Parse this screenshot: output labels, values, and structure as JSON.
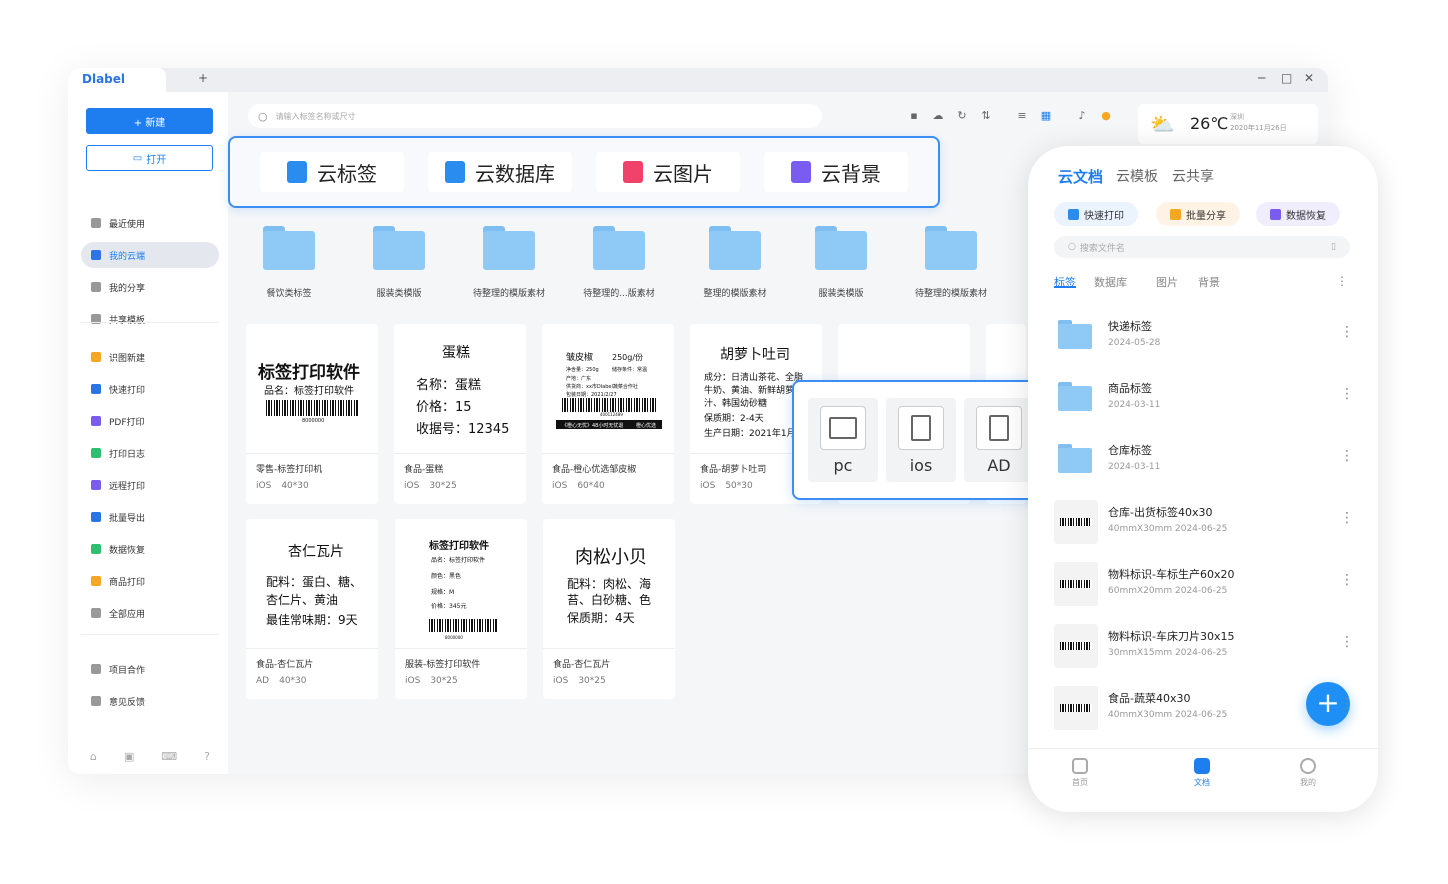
{
  "app": {
    "logo": "label",
    "new_tab": "+",
    "min": "─",
    "max": "□",
    "close": "✕"
  },
  "sidebar": {
    "new_button": "+ 新建",
    "open_button": "打开",
    "group1": [
      {
        "label": "最近使用",
        "color": "#999"
      },
      {
        "label": "我的云端",
        "color": "#2b74e6"
      },
      {
        "label": "我的分享",
        "color": "#999"
      },
      {
        "label": "共享模板",
        "color": "#999"
      }
    ],
    "group2": [
      {
        "label": "识图新建",
        "color": "#f5a623"
      },
      {
        "label": "快速打印",
        "color": "#2b74e6"
      },
      {
        "label": "PDF打印",
        "color": "#7b5cf0"
      },
      {
        "label": "打印日志",
        "color": "#2fbf71"
      },
      {
        "label": "远程打印",
        "color": "#7b5cf0"
      },
      {
        "label": "批量导出",
        "color": "#2b74e6"
      },
      {
        "label": "数据恢复",
        "color": "#2fbf71"
      },
      {
        "label": "商品打印",
        "color": "#f5a623"
      },
      {
        "label": "全部应用",
        "color": "#999"
      }
    ],
    "group3": [
      {
        "label": "项目合作",
        "color": "#999"
      },
      {
        "label": "意见反馈",
        "color": "#999"
      }
    ]
  },
  "search": {
    "placeholder": "请输入标签名称或尺寸"
  },
  "weather": {
    "temp": "26℃",
    "city": "深圳",
    "date": "2020年11月26日"
  },
  "cloud_tabs": [
    {
      "label": "云标签",
      "color": "#2b8cf0"
    },
    {
      "label": "云数据库",
      "color": "#2b8cf0"
    },
    {
      "label": "云图片",
      "color": "#f0426a"
    },
    {
      "label": "云背景",
      "color": "#7b5cf0"
    }
  ],
  "folders": [
    "餐饮类标签",
    "服装类模版",
    "待整理的模版素材",
    "待整理的...版素材",
    "整理的模版素材",
    "服装类模版",
    "待整理的模版素材"
  ],
  "cards": [
    {
      "name": "零售-标签打印机",
      "platform": "iOS",
      "size": "40*30",
      "p1": "标签打印软件",
      "p2": "品名：标签打印软件",
      "code": "8000000"
    },
    {
      "name": "食品-蛋糕",
      "platform": "iOS",
      "size": "30*25",
      "p1": "蛋糕",
      "p2": "名称：蛋糕",
      "p3": "价格：15",
      "p4": "收据号：12345"
    },
    {
      "name": "食品-橙心优选邹皮椒",
      "platform": "iOS",
      "size": "60*40",
      "p1": "皱皮椒",
      "p1b": "250g/份",
      "p2": "净含量：250g",
      "p2b": "储存条件：常温",
      "p3": "产地：广东",
      "p4": "供货商：xx市Dlabel蔬菜合作社",
      "p5": "包装日期：2021/2/27",
      "code": "400112489",
      "f1": "《橙心无忧》48小时无忧退",
      "f2": "橙心优选"
    },
    {
      "name": "食品-胡萝卜吐司",
      "platform": "iOS",
      "size": "50*30",
      "p1": "胡萝卜吐司",
      "p2": "成分：日清山茶花、全脂",
      "p3": "牛奶、黄油、新鲜胡萝",
      "p4": "汁、韩国幼砂糖",
      "p5": "保质期：2-4天",
      "p6": "生产日期：2021年1月"
    },
    {
      "name": "食品-杏仁瓦片",
      "platform": "AD",
      "size": "40*30",
      "p1": "杏仁瓦片",
      "p2": "配料：蛋白、糖、",
      "p3": "杏仁片、黄油",
      "p4": "最佳常味期：9天"
    },
    {
      "name": "服装-标签打印软件",
      "platform": "iOS",
      "size": "30*25",
      "p1": "标签打印软件",
      "p2": "品名：标签打印软件",
      "p3": "颜色：黑色",
      "p4": "规格：M",
      "p5": "价格：345元",
      "code": "8000000"
    },
    {
      "name": "食品-杏仁瓦片",
      "platform": "iOS",
      "size": "30*25",
      "p1": "肉松小贝",
      "p2": "配料：肉松、海",
      "p3": "苔、白砂糖、色",
      "p4": "保质期：4天"
    }
  ],
  "devices": [
    {
      "label": "pc"
    },
    {
      "label": "ios"
    },
    {
      "label": "AD"
    }
  ],
  "phone": {
    "tabs": [
      "云文档",
      "云模板",
      "云共享"
    ],
    "pills": [
      {
        "label": "快速打印",
        "bg": "#eaf3fe",
        "ic": "#2b8cf0"
      },
      {
        "label": "批量分享",
        "bg": "#fff3e6",
        "ic": "#f5a623"
      },
      {
        "label": "数据恢复",
        "bg": "#f0edfd",
        "ic": "#7b5cf0"
      }
    ],
    "search_placeholder": "搜索文件名",
    "subtabs": [
      "标签",
      "数据库",
      "图片",
      "背景"
    ],
    "rows": [
      {
        "title": "快递标签",
        "sub": "2024-05-28",
        "type": "folder"
      },
      {
        "title": "商品标签",
        "sub": "2024-03-11",
        "type": "folder"
      },
      {
        "title": "仓库标签",
        "sub": "2024-03-11",
        "type": "folder"
      },
      {
        "title": "仓库-出货标签40x30",
        "sub": "40mmX30mm  2024-06-25",
        "type": "file"
      },
      {
        "title": "物料标识-车标生产60x20",
        "sub": "60mmX20mm  2024-06-25",
        "type": "file"
      },
      {
        "title": "物料标识-车床刀片30x15",
        "sub": "30mmX15mm  2024-06-25",
        "type": "file"
      },
      {
        "title": "食品-蔬菜40x30",
        "sub": "40mmX30mm  2024-06-25",
        "type": "file"
      }
    ],
    "nav": [
      "首页",
      "文档",
      "我的"
    ],
    "fab": "+"
  }
}
